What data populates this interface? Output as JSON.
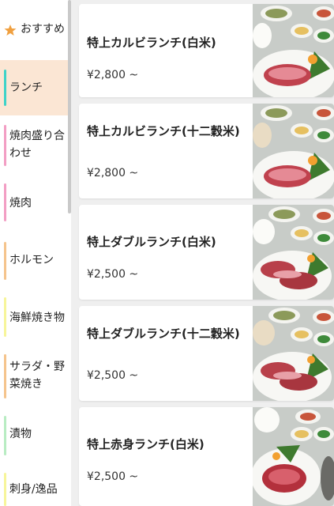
{
  "sidebar": {
    "favorite_label": "おすすめ",
    "items": [
      {
        "label": "ランチ",
        "color": "#3ed3c8",
        "active": true
      },
      {
        "label": "焼肉盛り合わせ",
        "color": "#f29ec4"
      },
      {
        "label": "焼肉",
        "color": "#f29ec4"
      },
      {
        "label": "ホルモン",
        "color": "#f5c48c"
      },
      {
        "label": "海鮮焼き物",
        "color": "#f7f59a"
      },
      {
        "label": "サラダ・野菜焼き",
        "color": "#f5c48c"
      },
      {
        "label": "漬物",
        "color": "#b8ecc2"
      },
      {
        "label": "刺身/逸品",
        "color": "#f7f59a"
      }
    ]
  },
  "menu": {
    "items": [
      {
        "name": "特上カルビランチ(白米)",
        "price": "¥2,800 ~"
      },
      {
        "name": "特上カルビランチ(十二穀米)",
        "price": "¥2,800 ~"
      },
      {
        "name": "特上ダブルランチ(白米)",
        "price": "¥2,500 ~"
      },
      {
        "name": "特上ダブルランチ(十二穀米)",
        "price": "¥2,500 ~"
      },
      {
        "name": "特上赤身ランチ(白米)",
        "price": "¥2,500 ~"
      }
    ]
  },
  "colors": {
    "accent": "#f0a040",
    "active_bg": "#fbe6d4",
    "main_bg": "#efefef"
  }
}
